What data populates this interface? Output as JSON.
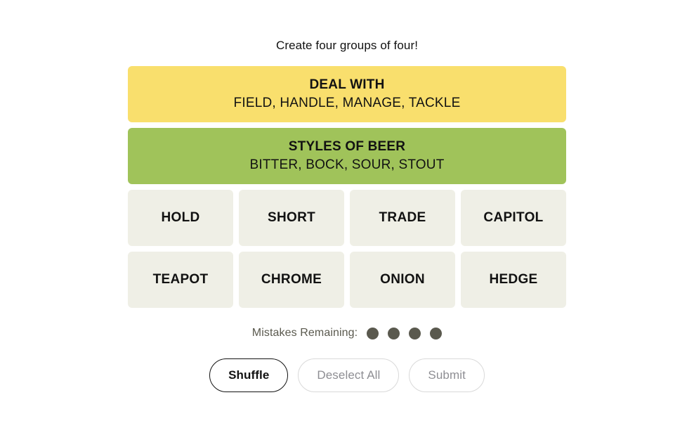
{
  "game": {
    "subtitle": "Create four groups of four!"
  },
  "solved_groups": [
    {
      "title": "DEAL WITH",
      "members": "FIELD, HANDLE, MANAGE, TACKLE",
      "color": "#f9df6d"
    },
    {
      "title": "STYLES OF BEER",
      "members": "BITTER, BOCK, SOUR, STOUT",
      "color": "#a0c35a"
    }
  ],
  "tiles": {
    "rows": [
      [
        "HOLD",
        "SHORT",
        "TRADE",
        "CAPITOL"
      ],
      [
        "TEAPOT",
        "CHROME",
        "ONION",
        "HEDGE"
      ]
    ],
    "background": "#efefe6"
  },
  "mistakes": {
    "label": "Mistakes Remaining:",
    "remaining": 4,
    "dot_color": "#5a594e"
  },
  "actions": {
    "shuffle_label": "Shuffle",
    "deselect_label": "Deselect All",
    "submit_label": "Submit",
    "enabled_border": "#121212",
    "disabled_text": "#8e8e93",
    "disabled_border": "#d9d9d9"
  }
}
